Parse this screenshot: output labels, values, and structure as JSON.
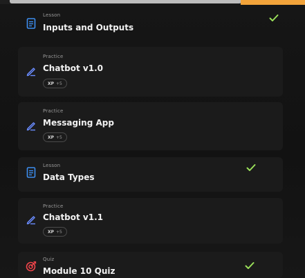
{
  "items": [
    {
      "kind": "Lesson",
      "title": "Inputs and Outputs",
      "icon": "document-icon",
      "completed": true
    },
    {
      "kind": "Practice",
      "title": "Chatbot v1.0",
      "icon": "pencil-icon",
      "xp_label": "XP",
      "xp_value": "+5"
    },
    {
      "kind": "Practice",
      "title": "Messaging App",
      "icon": "pencil-icon",
      "xp_label": "XP",
      "xp_value": "+5"
    },
    {
      "kind": "Lesson",
      "title": "Data Types",
      "icon": "document-icon",
      "completed": true
    },
    {
      "kind": "Practice",
      "title": "Chatbot v1.1",
      "icon": "pencil-icon",
      "xp_label": "XP",
      "xp_value": "+5"
    },
    {
      "kind": "Quiz",
      "title": "Module 10 Quiz",
      "icon": "target-icon",
      "completed": true
    }
  ],
  "colors": {
    "lesson_icon": "#3d8ef0",
    "practice_icon": "#6a8cff",
    "quiz_icon": "#f0454b",
    "check": "#9be15a",
    "accent": "#f2a33a"
  }
}
